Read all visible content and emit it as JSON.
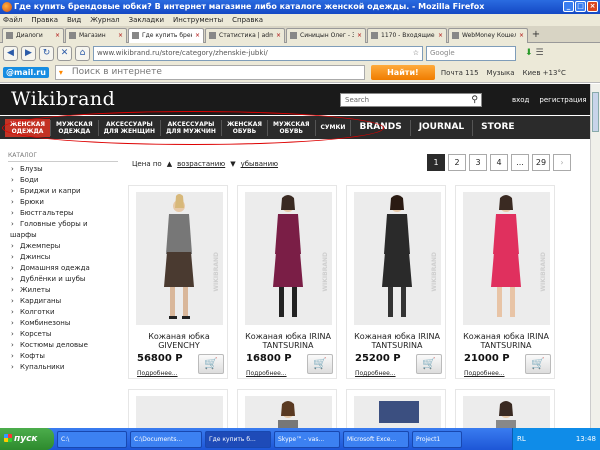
{
  "window": {
    "title": "Где купить брендовые юбки? В интернет магазине либо каталоге женской одежды. - Mozilla Firefox"
  },
  "menu": [
    "Файл",
    "Правка",
    "Вид",
    "Журнал",
    "Закладки",
    "Инструменты",
    "Справка"
  ],
  "tabs": [
    {
      "label": "Диалоги"
    },
    {
      "label": "Магазин"
    },
    {
      "label": "Где купить брен..."
    },
    {
      "label": "Статистика | adm..."
    },
    {
      "label": "Синицын Олег - З..."
    },
    {
      "label": "1170 - Входящие ..."
    },
    {
      "label": "WebMoney Кошел..."
    }
  ],
  "nav": {
    "url": "www.wikibrand.ru/store/category/zhenskie-jubki/",
    "search_placeholder": "Google",
    "icons": [
      "back-icon",
      "forward-icon",
      "reload-icon",
      "stop-icon",
      "home-icon",
      "download-icon"
    ]
  },
  "mailbar": {
    "logo": "@mail.ru",
    "placeholder": "Поиск в интернете",
    "find_label": "Найти!",
    "mail_label": "Почта 115",
    "music_label": "Музыка",
    "weather_label": "Киев +13°C"
  },
  "site": {
    "logo": "Wikibrand",
    "search_placeholder": "Search",
    "login": "вход",
    "register": "регистрация",
    "categories": [
      {
        "line1": "ЖЕНСКАЯ",
        "line2": "ОДЕЖДА"
      },
      {
        "line1": "МУЖСКАЯ",
        "line2": "ОДЕЖДА"
      },
      {
        "line1": "АКСЕССУАРЫ",
        "line2": "ДЛЯ ЖЕНЩИН"
      },
      {
        "line1": "АКСЕССУАРЫ",
        "line2": "ДЛЯ МУЖЧИН"
      },
      {
        "line1": "ЖЕНСКАЯ",
        "line2": "ОБУВЬ"
      },
      {
        "line1": "МУЖСКАЯ",
        "line2": "ОБУВЬ"
      },
      {
        "line1": "СУМКИ",
        "line2": ""
      }
    ],
    "bignav": [
      "BRANDS",
      "JOURNAL",
      "STORE"
    ],
    "catalog_title": "КАТАЛОГ",
    "catalog": [
      "Блузы",
      "Боди",
      "Бриджи и капри",
      "Брюки",
      "Бюстгальтеры",
      "Головные уборы и"
    ],
    "catalog_cont": "шарфы",
    "catalog2": [
      "Джемперы",
      "Джинсы",
      "Домашняя одежда",
      "Дублёнки и шубы",
      "Жилеты",
      "Кардиганы",
      "Колготки",
      "Комбинезоны",
      "Корсеты",
      "Костюмы деловые",
      "Кофты",
      "Купальники"
    ],
    "sort": {
      "prefix": "Цена по",
      "asc": "возрастанию",
      "desc": "убыванию"
    },
    "pages": [
      "1",
      "2",
      "3",
      "4",
      "...",
      "29",
      "›"
    ],
    "products": [
      {
        "name1": "Кожаная юбка",
        "name2": "GIVENCHY",
        "price": "56800 Р",
        "more": "Подробнее...",
        "dress": "#4a3a30",
        "top": "#777"
      },
      {
        "name1": "Кожаная юбка IRINA",
        "name2": "TANTSURINA",
        "price": "16800 Р",
        "more": "Подробнее...",
        "dress": "#7a1e46",
        "top": "#7a1e46"
      },
      {
        "name1": "Кожаная юбка IRINA",
        "name2": "TANTSURINA",
        "price": "25200 Р",
        "more": "Подробнее...",
        "dress": "#2a2a2a",
        "top": "#2a2a2a"
      },
      {
        "name1": "Кожаная юбка IRINA",
        "name2": "TANTSURINA",
        "price": "21000 Р",
        "more": "Подробнее...",
        "dress": "#e0305e",
        "top": "#e0305e"
      }
    ],
    "watermark": "WIKIBRAND"
  },
  "taskbar": {
    "start": "пуск",
    "tasks": [
      "C:\\",
      "C:\\Documents...",
      "Где купить б...",
      "Skype™ - vas...",
      "Microsoft Exce...",
      "Project1"
    ],
    "lang": "RL",
    "time": "13:48"
  }
}
